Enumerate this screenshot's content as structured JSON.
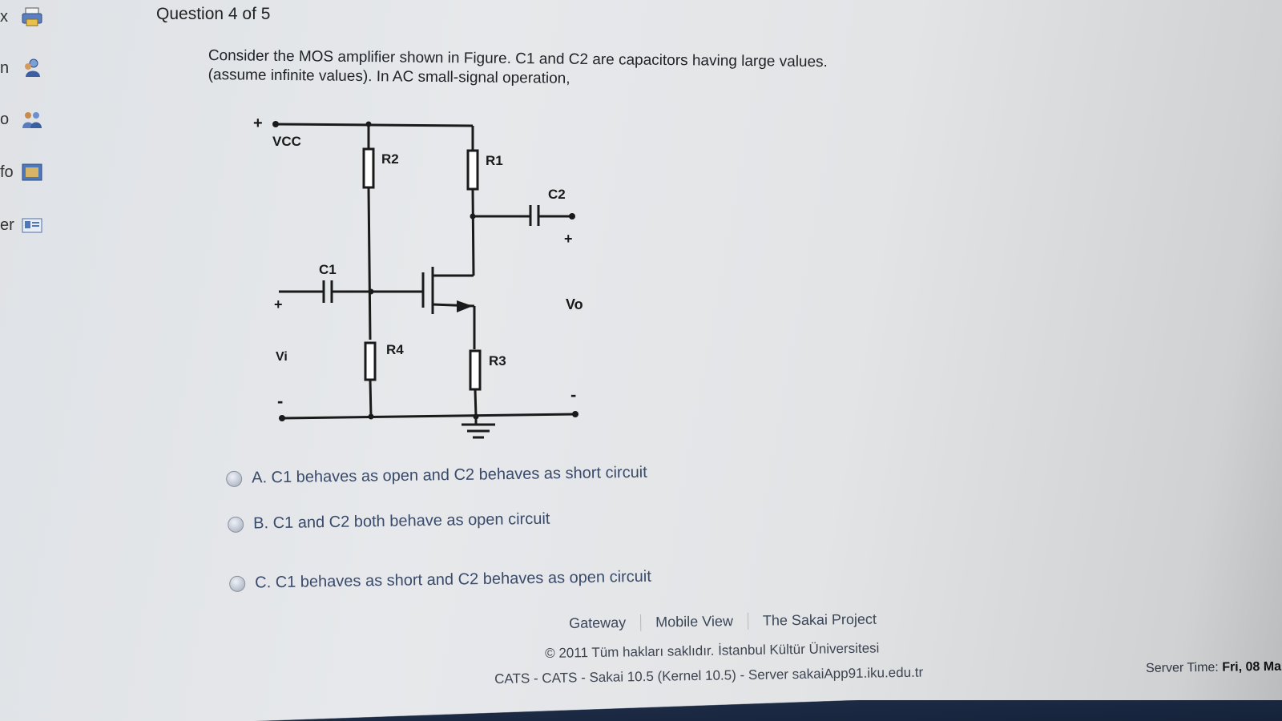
{
  "sidebar": {
    "items": [
      {
        "label": "x",
        "icon": "print-icon"
      },
      {
        "label": "n",
        "icon": "users-icon"
      },
      {
        "label": "o",
        "icon": "group-icon"
      },
      {
        "label": "fo",
        "icon": "folder-icon"
      },
      {
        "label": "er",
        "icon": "roster-icon"
      }
    ]
  },
  "question": {
    "title": "Question 4 of 5",
    "text_line1": "Consider the MOS amplifier shown in Figure. C1 and C2 are capacitors having large values.",
    "text_line2": "(assume infinite values). In AC small-signal operation,"
  },
  "circuit": {
    "vcc": "VCC",
    "r1": "R1",
    "r2": "R2",
    "r3": "R3",
    "r4": "R4",
    "c1": "C1",
    "c2": "C2",
    "vi": "Vi",
    "vo": "Vo",
    "plus": "+",
    "minus": "-"
  },
  "options": [
    {
      "label": "A. C1 behaves as open and C2 behaves as short circuit"
    },
    {
      "label": "B. C1 and C2 both behave as open circuit"
    },
    {
      "label": "C. C1 behaves as short and C2 behaves as open circuit"
    }
  ],
  "footer": {
    "links": [
      "Gateway",
      "Mobile View",
      "The Sakai Project"
    ],
    "copyright": "© 2011 Tüm hakları saklıdır. İstanbul Kültür Üniversitesi",
    "build": "CATS - CATS - Sakai 10.5 (Kernel 10.5) - Server sakaiApp91.iku.edu.tr",
    "server_time_label": "Server Time:",
    "server_time_value": "Fri, 08 Ma"
  }
}
